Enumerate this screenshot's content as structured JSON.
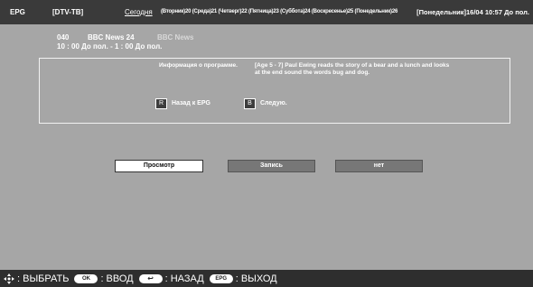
{
  "header": {
    "epg": "EPG",
    "source": "[DTV-TB]",
    "today": "Сегодня",
    "days": "(Вторник)20 (Среда)21 (Четверг)22 (Пятница)23 (Суббота)24 (Воскресенье)25 (Понедельник)26",
    "datetime": "[Понедельник]16/04  10:57 До пол."
  },
  "program": {
    "channel_number": "040",
    "channel_name": "BBC News 24",
    "title": "BBC News",
    "time": "10 : 00 До пол. - 1 : 00 До пол."
  },
  "info": {
    "label": "Информация о программе.",
    "text": "[Age 5 - 7] Paul Ewing reads the story of a bear and a lunch and looks at the end sound the words bug and dog.",
    "back_key": "R",
    "back_label": "Назад к EPG",
    "next_key": "B",
    "next_label": "Следую."
  },
  "actions": {
    "view": "Просмотр",
    "record": "Запись",
    "no": "нет"
  },
  "footer": {
    "select": ": ВЫБРАТЬ",
    "ok_key": "OK",
    "enter": ": ВВОД",
    "back_key": "↩",
    "back": ": НАЗАД",
    "epg_key": "EPG",
    "exit": ": ВЫХОД"
  },
  "colors": {
    "background": "#a6a6a6",
    "bars": "#3a3a3a",
    "selected_button": "#ffffff",
    "inactive_button": "#777777"
  }
}
